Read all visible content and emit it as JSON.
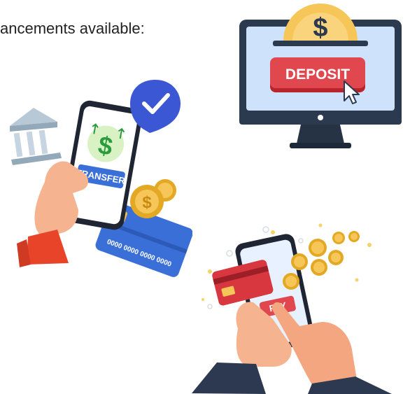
{
  "caption": "ancements available:",
  "deposit": {
    "coin_symbol": "$",
    "button_label": "DEPOSIT",
    "icons": [
      "coin-icon",
      "monitor-icon",
      "cursor-icon"
    ]
  },
  "transfer": {
    "coin_symbol": "$",
    "button_label": "TRANSFER",
    "card_number": "0000 0000 0000 0000",
    "icons": [
      "bank-icon",
      "checkmark-badge-icon",
      "phone-icon",
      "credit-card-icon",
      "coin-icon"
    ]
  },
  "pay": {
    "button_label": "PAY",
    "coin_symbol": "$",
    "icons": [
      "phone-icon",
      "credit-card-icon",
      "coin-icon"
    ]
  }
}
